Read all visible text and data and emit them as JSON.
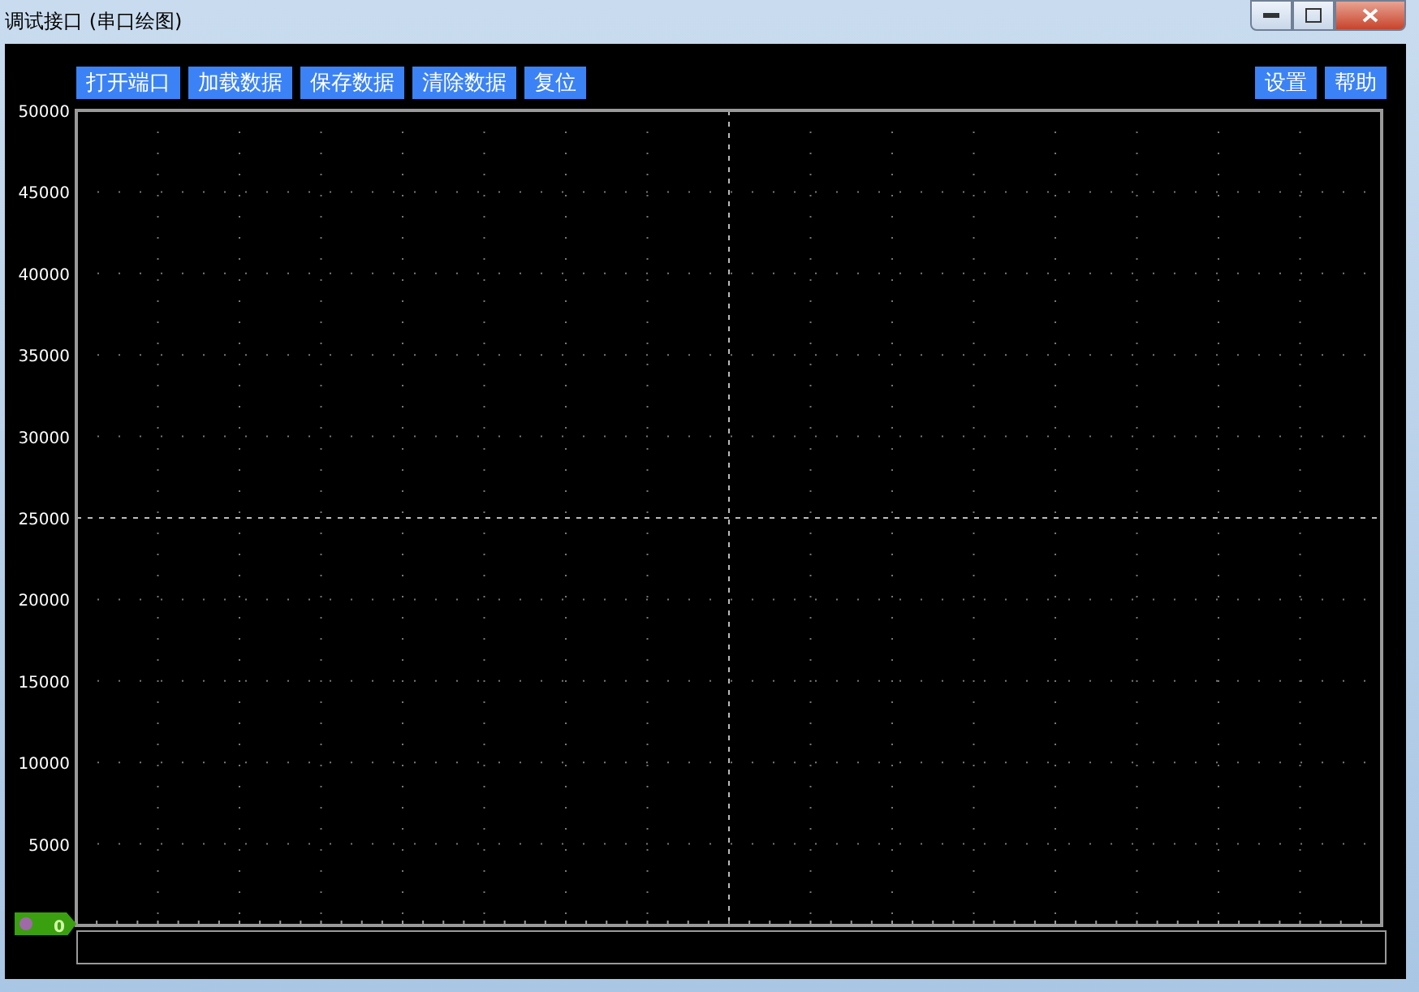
{
  "window": {
    "title": "调试接口 (串口绘图)"
  },
  "toolbar": {
    "left_buttons": [
      "打开端口",
      "加载数据",
      "保存数据",
      "清除数据",
      "复位"
    ],
    "right_buttons": [
      "设置",
      "帮助"
    ]
  },
  "plot": {
    "y_axis_labels": [
      "50000",
      "45000",
      "40000",
      "35000",
      "30000",
      "25000",
      "20000",
      "15000",
      "10000",
      "5000",
      "0"
    ],
    "channel_marker": {
      "color": "#3aa010"
    }
  }
}
